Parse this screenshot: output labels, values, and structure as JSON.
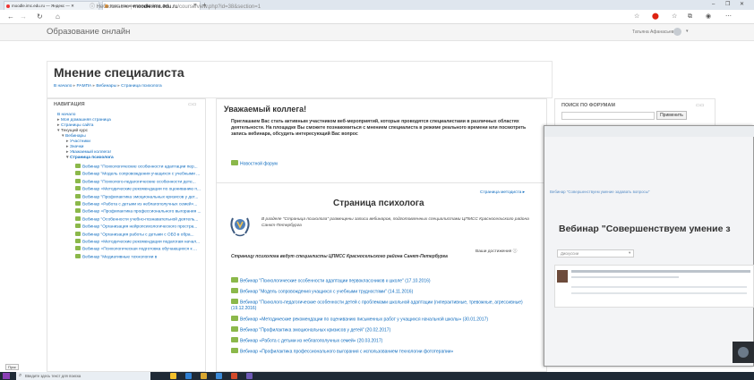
{
  "browser": {
    "tabs": [
      {
        "label": "moodle.imc.edu.ru — Яндекс — ✕",
        "active": false
      },
      {
        "label": "Курс: Мнение специалиста. Те...",
        "active": true
      }
    ],
    "new_tab": "+",
    "url_secure_label": "Небезопасно",
    "url_host": "moodle.imc.edu.ru",
    "url_path": "/course/view.php?id=38&section=1",
    "window_controls": [
      "–",
      "❐",
      "✕"
    ]
  },
  "header": {
    "site_name": "Образование онлайн",
    "user_name": "Татьяна Афанасьева"
  },
  "page": {
    "title": "Мнение специалиста",
    "breadcrumbs": [
      "В начало",
      "РАМПА",
      "Вебинары",
      "Страница психолога"
    ]
  },
  "nav_block": {
    "heading": "НАВИГАЦИЯ",
    "items": [
      {
        "label": "В начало",
        "level": 0,
        "marker": ""
      },
      {
        "label": "Моя домашняя страница",
        "level": 1,
        "marker": "▸"
      },
      {
        "label": "Страницы сайта",
        "level": 1,
        "marker": "▸"
      },
      {
        "label": "Текущий курс",
        "level": 1,
        "marker": "▾"
      },
      {
        "label": "Вебинары",
        "level": 2,
        "marker": "▾"
      },
      {
        "label": "Участники",
        "level": 3,
        "marker": "▸"
      },
      {
        "label": "Значки",
        "level": 3,
        "marker": "▸"
      },
      {
        "label": "Уважаемый коллега!",
        "level": 3,
        "marker": "▸"
      },
      {
        "label": "Страница психолога",
        "level": 3,
        "marker": "▾"
      }
    ],
    "webinars": [
      "Вебинар \"Психологические особенности адаптации пер...",
      "Вебинар \"Модель сопровождения учащихся с учебными ...",
      "Вебинар \"Психолого-педагогические особенности дете...",
      "Вебинар «Методические рекомендации по оцениванию п...",
      "Вебинар \"Профилактика эмоциональных кризисов у дет...",
      "Вебинар «Работа с детьми из неблагополучных семей»...",
      "Вебинар «Профилактика профессионального выгорания ...",
      "Вебинар \"Особенности учебно-познавательной деятель...",
      "Вебинар \"Организация нейропсихологического простра...",
      "Вебинар \"Организация работы с детьми с ОВЗ в обра...",
      "Вебинар «Методические рекомендации педагогам начал...",
      "Вебинар «Психологическая подготовка обучающихся к ...",
      "Вебинар \"Медиативные технологии в"
    ]
  },
  "main": {
    "welcome_title": "Уважаемый коллега!",
    "invite_text": "Приглашаем Вас стать активным участником веб-мероприятий, которые проводятся специалистами в различных областях деятельности. На площадке Вы сможете познакомиться с мнением специалиста в режиме реального времени или посмотреть запись вебинара, обсудить интересующий Вас вопрос",
    "forum_link": "Новостной форум",
    "methodist_link": "Страница методиста ▸",
    "psychologist_title": "Страница психолога",
    "psychologist_intro": "В разделе \"Страница психолога\" размещены записи вебинаров, подготовленных специалистами ЦПМСС Красносельского района Санкт-Петербурга",
    "achievements": "Ваши достижения ⓘ",
    "leaders_text": "Страницу психолога ведут специалисты ЦПМСС Красносельского района Санкт-Петербурга",
    "webinar_links": [
      "Вебинар \"Психологические особенности адаптации первоклассников к школе\" (17.10.2016)",
      "Вебинар \"Модель сопровождения учащихся с учебными трудностями\" (14.11.2016)",
      "Вебинар \"Психолого-педагогические особенности детей с проблемами школьной адаптации (гиперактивные, тревожные, агрессивные) (19.12.2016)",
      "Вебинар «Методические рекомендации по оцениванию письменных работ у учащихся начальной школы» (30.01.2017)",
      "Вебинар \"Профилактика эмоциональных кризисов у детей\" (20.02.2017)",
      "Вебинар «Работа с детьми из неблагополучных семей» (20.03.2017)",
      "Вебинар «Профилактика профессионального выгорания с использованием технологии фототерапии»"
    ]
  },
  "search_block": {
    "heading": "ПОИСК ПО ФОРУМАМ",
    "input_value": "",
    "apply_label": "Применить"
  },
  "overlay": {
    "breadcrumb": "Вебинар \"Совершенствуем умение задавать вопросы\"",
    "title": "Вебинар \"Совершенствуем умение з",
    "select_value": "Дискуссии"
  },
  "taskbar": {
    "search_placeholder": "Введите здесь текст для поиска",
    "tooltip": "Пуск"
  },
  "colors": {
    "link": "#0f6cbf",
    "forum_icon": "#8bb84a",
    "taskbar": "#1f2a36"
  }
}
